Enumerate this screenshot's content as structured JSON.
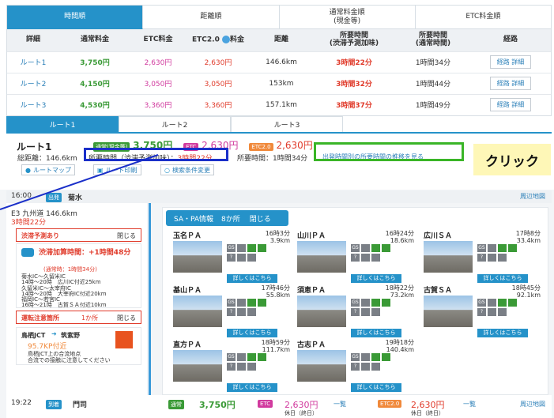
{
  "sort_tabs": [
    {
      "label": "時間順"
    },
    {
      "label": "距離順"
    },
    {
      "label": "通常料金順",
      "sub": "(現金等)"
    },
    {
      "label": "ETC料金順"
    }
  ],
  "table": {
    "headers": [
      "詳細",
      "通常料金",
      "ETC料金",
      "ETC2.0",
      "料金",
      "距離",
      "所要時間",
      "(渋滞予測加味)",
      "所要時間",
      "(通常時間)",
      "経路"
    ],
    "rows": [
      {
        "name": "ルート1",
        "normal": "3,750円",
        "etc": "2,630円",
        "etc2": "2,630円",
        "dist": "146.6km",
        "time": "3時間22分",
        "usual": "1時間34分"
      },
      {
        "name": "ルート2",
        "normal": "4,150円",
        "etc": "3,050円",
        "etc2": "3,050円",
        "dist": "153km",
        "time": "3時間32分",
        "usual": "1時間44分"
      },
      {
        "name": "ルート3",
        "normal": "4,530円",
        "etc": "3,360円",
        "etc2": "3,360円",
        "dist": "157.1km",
        "time": "3時間37分",
        "usual": "1時間49分"
      }
    ],
    "detail_btn": "経路 詳細"
  },
  "route_tabs": [
    "ルート1",
    "ルート2",
    "ルート3"
  ],
  "summary": {
    "title": "ルート1",
    "normal_tag": "通常(現金等)",
    "normal_price": "3,750円",
    "etc_tag": "ETC",
    "etc_price": "2,630円",
    "etc2_tag": "ETC2.0",
    "etc2_price": "2,630円",
    "distance": "総距離：146.6km",
    "jam_label": "所要時間（渋滞予測加味）：",
    "jam_time": "3時間22分",
    "usual": "所要時間：1時間34分",
    "trend_link": "出発時間別の所要時間の推移を見る",
    "btn_map": "ルートマップ",
    "btn_print": "ルート印刷",
    "btn_cond": "検索条件変更"
  },
  "annotation": "クリック",
  "start": {
    "time": "16:00",
    "tag": "出発",
    "name": "菊水",
    "map": "周辺地図"
  },
  "leg": {
    "road": "E3 九州道 146.6km",
    "time": "3時間22分"
  },
  "jam_card": {
    "title": "渋滞予測あり",
    "close": "閉じる",
    "extra": "渋滞加算時間：+1時間48分",
    "usual": "(通常時：1時間34分)",
    "lines": [
      "菊水IC～久留米IC",
      "14時～20時　広川IC付近25km",
      "久留米IC～太宰府IC",
      "14時～20時　大宰府IC付近20km",
      "福岡IC～若宮IC",
      "16時～21時　古賀ＳＡ付近10km"
    ]
  },
  "caution_card": {
    "title": "運転注意箇所",
    "count": "1か所",
    "close": "閉じる",
    "jct": "鳥栖JCT",
    "to": "筑紫野",
    "kp": "95.7KP付近",
    "desc1": "鳥栖JCT上の合流地点",
    "desc2": "合流での接触に注意してください"
  },
  "sapa": {
    "title": "SA・PA情報",
    "count": "8か所",
    "close": "閉じる",
    "more": "詳しくはこちら",
    "spots": [
      {
        "name": "玉名ＰＡ",
        "time": "16時3分",
        "dist": "3.9km"
      },
      {
        "name": "山川ＰＡ",
        "time": "16時24分",
        "dist": "18.6km"
      },
      {
        "name": "広川ＳＡ",
        "time": "17時8分",
        "dist": "33.4km"
      },
      {
        "name": "基山ＰＡ",
        "time": "17時46分",
        "dist": "55.8km"
      },
      {
        "name": "須恵ＰＡ",
        "time": "18時22分",
        "dist": "73.2km"
      },
      {
        "name": "古賀ＳＡ",
        "time": "18時45分",
        "dist": "92.1km"
      },
      {
        "name": "直方ＰＡ",
        "time": "18時59分",
        "dist": "111.7km"
      },
      {
        "name": "古志ＰＡ",
        "time": "19時18分",
        "dist": "140.4km"
      }
    ]
  },
  "arrive": {
    "time": "19:22",
    "tag": "到着",
    "name": "門司",
    "normal_tag": "通常",
    "normal": "3,750円",
    "etc_tag": "ETC",
    "etc": "2,630円",
    "etc2_tag": "ETC2.0",
    "etc2": "2,630円",
    "holiday": "休日（終日）",
    "list": "一覧",
    "map": "周辺地図"
  },
  "colors": {
    "accent": "#2592c9",
    "highlight_blue": "#1a2fc9",
    "highlight_green": "#3ab527",
    "callout": "#fef7b7"
  }
}
